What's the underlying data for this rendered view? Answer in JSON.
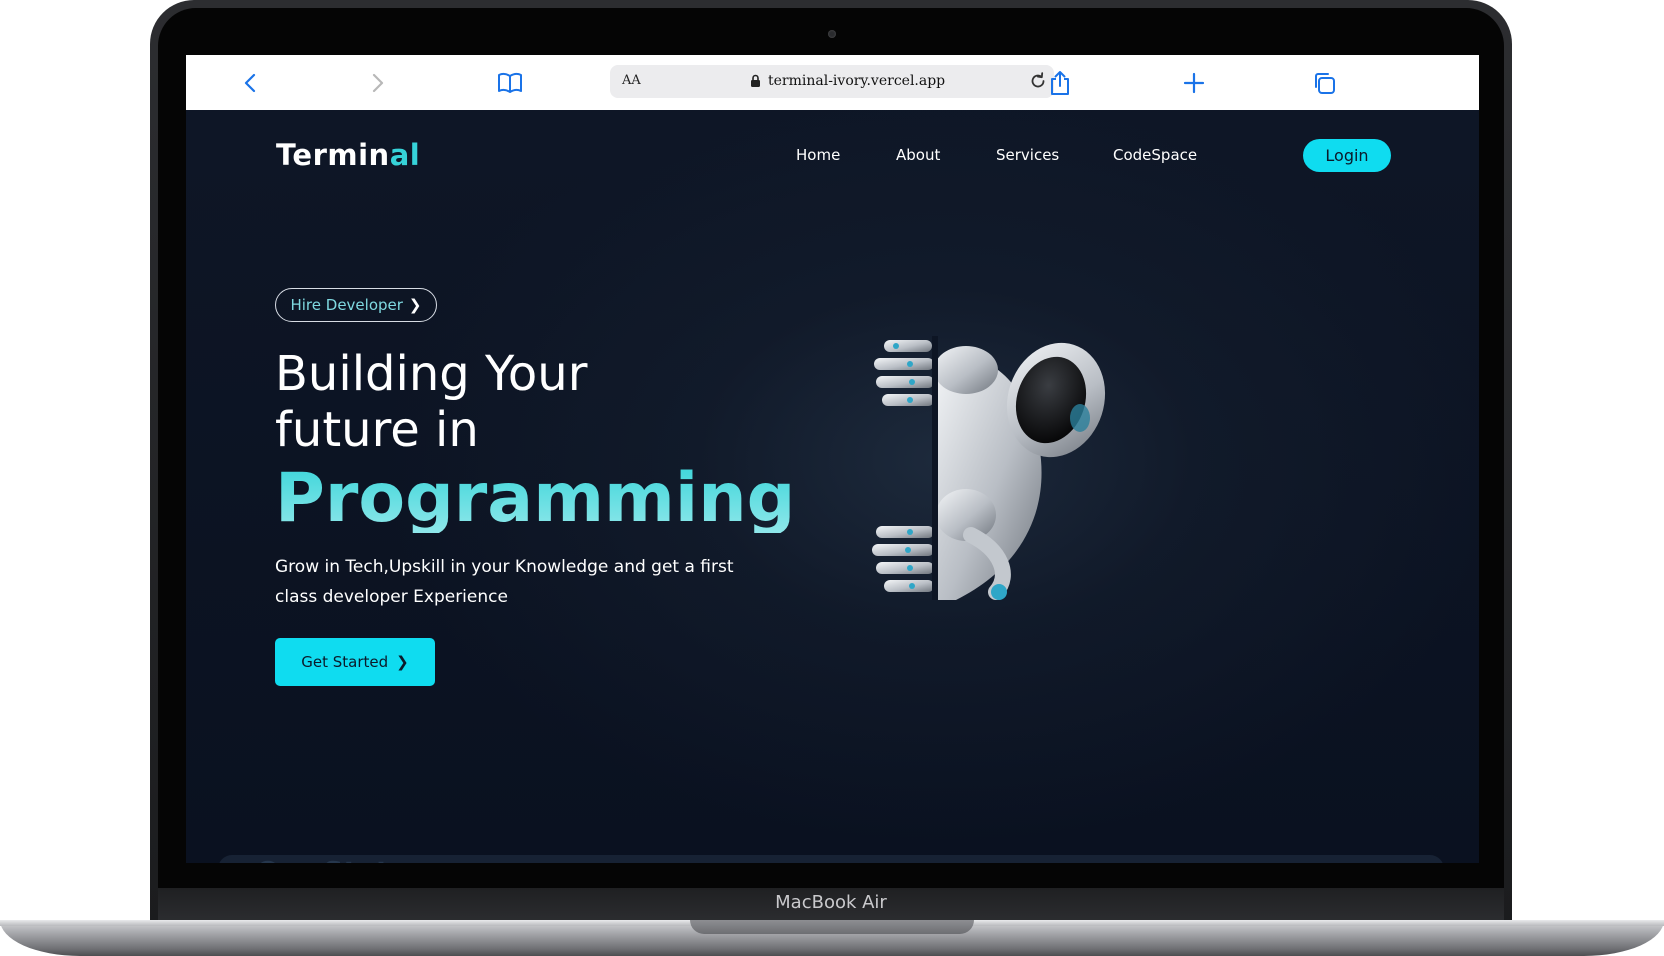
{
  "device": {
    "label": "MacBook Air"
  },
  "browser": {
    "text_size": "AA",
    "url": "terminal-ivory.vercel.app"
  },
  "site": {
    "logo": {
      "main": "Termin",
      "accent": "al"
    },
    "nav": [
      "Home",
      "About",
      "Services",
      "CodeSpace"
    ],
    "login": "Login"
  },
  "hero": {
    "badge": "Hire Developer",
    "title_line1": "Building Your",
    "title_line2": "future in",
    "highlight": "Programming",
    "subtitle": "Grow in Tech,Upskill in your Knowledge and get a first class developer Experience",
    "cta": "Get Started"
  },
  "stats": {
    "title": "Our Stats"
  },
  "colors": {
    "accent": "#0fdcf0",
    "logo_accent": "#36d3d9",
    "background": "#0b1220"
  }
}
